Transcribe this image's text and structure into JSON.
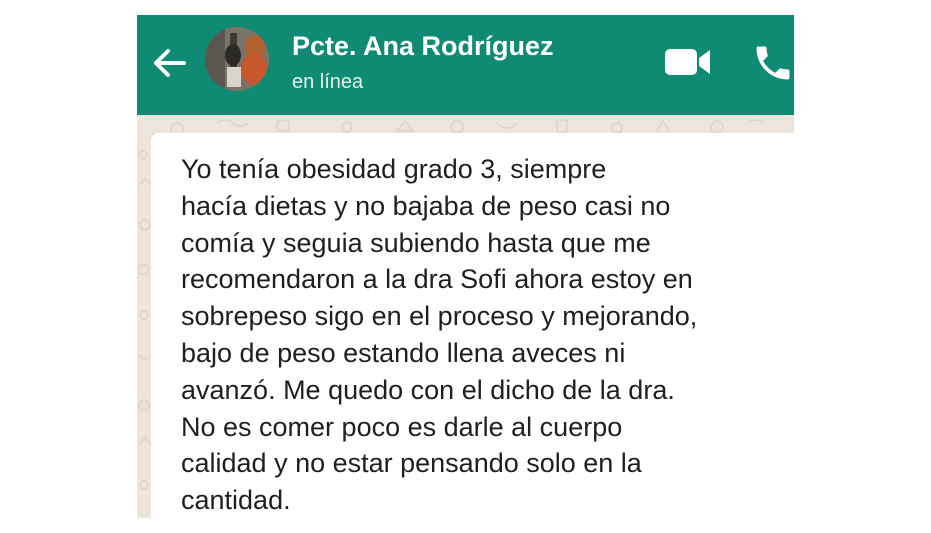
{
  "colors": {
    "header": "#0f8a73",
    "wallpaper": "#ece5dd",
    "bubble": "#ffffff",
    "header_text": "#ffffff",
    "message_text": "#1f1f1f"
  },
  "header": {
    "back_icon": "arrow-left",
    "avatar": "contact-photo",
    "contact_name": "Pcte. Ana Rodríguez",
    "status": "en línea",
    "video_icon": "video-camera",
    "call_icon": "phone"
  },
  "message": {
    "text": "Yo tenía obesidad grado 3, siempre\nhacía dietas y no bajaba de peso casi no\ncomía y seguia subiendo hasta que me\nrecomendaron a la dra Sofi ahora estoy en\nsobrepeso sigo en el proceso y mejorando,\nbajo de peso estando llena aveces ni\navanzó. Me quedo con el dicho de la dra.\nNo es comer poco es darle al cuerpo\ncalidad y no estar pensando solo en la\ncantidad."
  }
}
